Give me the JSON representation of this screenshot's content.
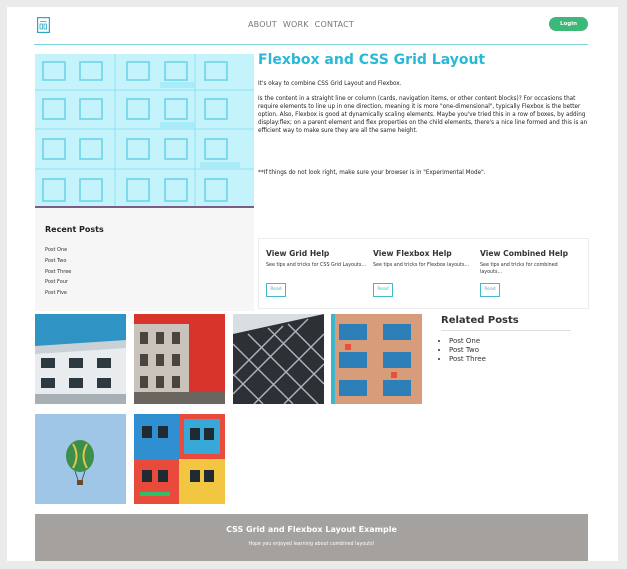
{
  "header": {
    "logo_icon": "layout-grid-icon",
    "nav": [
      "ABOUT",
      "WORK",
      "CONTACT"
    ],
    "login_label": "Login",
    "accent": "#3cb878"
  },
  "main": {
    "title": "Flexbox and CSS Grid Layout",
    "intro": "It's okay to combine CSS Grid Layout and Flexbox.",
    "paragraph": "Is the content in a straight line or column (cards, navigation items, or other content blocks)? For occasions that require elements to line up in one direction, meaning it is more \"one-dimensional\", typically Flexbox is the better option. Also, Flexbox is good at dynamically scaling elements. Maybe you've tried this in a row of boxes, by adding display:flex; on a parent element and flex properties on the child elements, there's a nice line formed and this is an efficient way to make sure they are all the same height.",
    "note": "**If things do not look right, make sure your browser is in \"Experimental Mode\".",
    "title_color": "#29b8d8"
  },
  "recent_posts": {
    "heading": "Recent Posts",
    "items": [
      "Post One",
      "Post Two",
      "Post Three",
      "Post Four",
      "Post Five"
    ]
  },
  "help_cards": [
    {
      "title": "View Grid Help",
      "text": "See tips and tricks for CSS Grid Layouts...",
      "button": "Read"
    },
    {
      "title": "View Flexbox Help",
      "text": "See tips and tricks for Flexbox layouts...",
      "button": "Read"
    },
    {
      "title": "View Combined Help",
      "text": "See tips and tricks for combined layouts...",
      "button": "Read"
    }
  ],
  "related_posts": {
    "heading": "Related Posts",
    "items": [
      "Post One",
      "Post Two",
      "Post Three"
    ]
  },
  "footer": {
    "title": "CSS Grid and Flexbox Layout Example",
    "subtitle": "Hope you enjoyed learning about combined layouts!"
  }
}
